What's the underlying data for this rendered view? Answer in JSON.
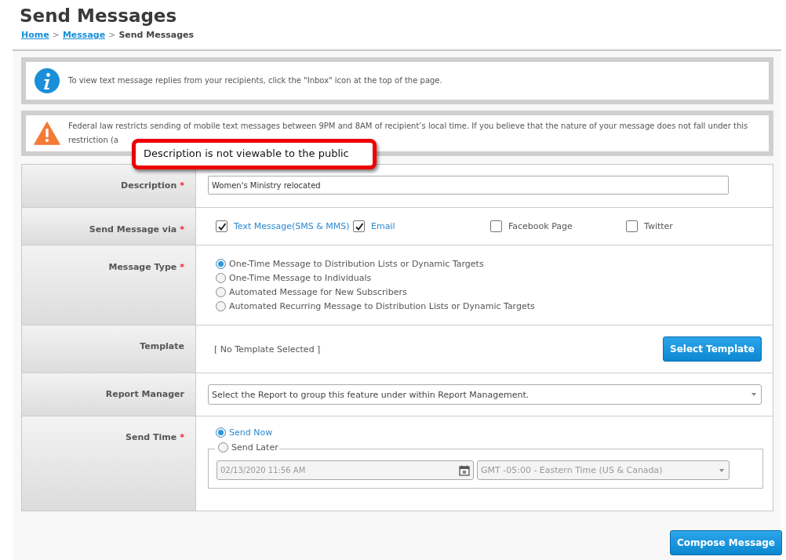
{
  "page_title": "Send Messages",
  "breadcrumb": {
    "separator": ">",
    "items": [
      {
        "label": "Home",
        "link": true
      },
      {
        "label": "Message",
        "link": true
      },
      {
        "label": "Send Messages",
        "link": false
      }
    ]
  },
  "notices": [
    {
      "kind": "info",
      "text": "To view text message replies from your recipients, click the \"Inbox\" icon at the top of the page."
    },
    {
      "kind": "warning",
      "text": "Federal law restricts sending of mobile text messages between 9PM and 8AM of recipient’s local time. If you believe that the nature of your message does not fall under this restriction (a"
    }
  ],
  "tooltip": "Description is not viewable to the public",
  "form_rows": [
    {
      "kind": "text",
      "label": "Description",
      "required_mark": "*",
      "value": "Women's Ministry relocated"
    },
    {
      "kind": "checkboxes",
      "label": "Send Message via",
      "required_mark": "*",
      "options": [
        {
          "label": "Text Message(SMS & MMS)",
          "checked": true
        },
        {
          "label": "Email",
          "checked": true
        },
        {
          "label": "Facebook Page",
          "checked": false
        },
        {
          "label": "Twitter",
          "checked": false
        }
      ]
    },
    {
      "kind": "radios",
      "label": "Message Type",
      "required_mark": "*",
      "options": [
        {
          "label": "One-Time Message to Distribution Lists or Dynamic Targets",
          "selected": true
        },
        {
          "label": "One-Time Message to Individuals",
          "selected": false
        },
        {
          "label": "Automated Message for New Subscribers",
          "selected": false
        },
        {
          "label": "Automated Recurring Message to Distribution Lists or Dynamic Targets",
          "selected": false
        }
      ]
    },
    {
      "kind": "template",
      "label": "Template",
      "value": "[ No Template Selected ]",
      "button": "Select Template"
    },
    {
      "kind": "select",
      "label": "Report Manager",
      "value": "Select the Report to group this feature under within Report Management."
    },
    {
      "kind": "sendtime",
      "label": "Send Time",
      "required_mark": "*",
      "options": [
        {
          "label": "Send Now",
          "selected": true
        },
        {
          "label": "Send Later",
          "selected": false
        }
      ],
      "date": "02/13/2020 11:56 AM",
      "timezone": "GMT -05:00 - Eastern Time (US & Canada)",
      "disabled": true
    }
  ],
  "submit_button": "Compose Message"
}
